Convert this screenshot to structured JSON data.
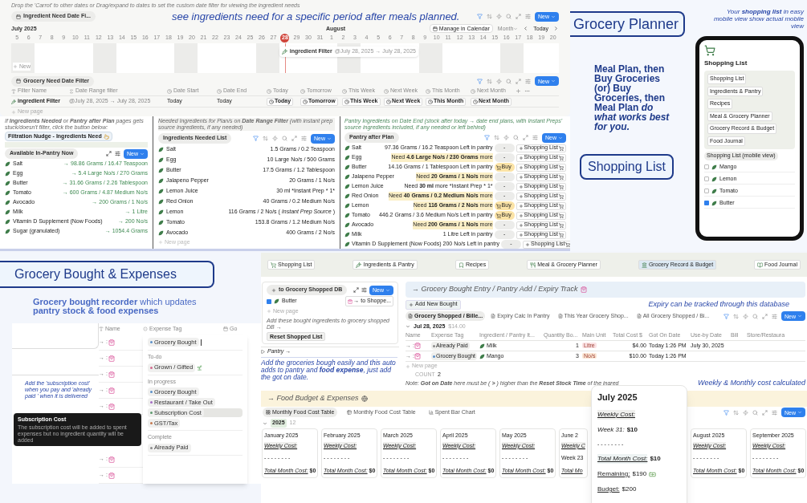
{
  "timeline_panel": {
    "hint": "Drop the 'Carrot' to other dates or Drag/expand to dates to set the custom date filter for viewing the ingredient needs",
    "view_tab": "Ingredient Need Date Fi...",
    "annotation": "see ingredients need for a specific period after meals planned.",
    "new_button": "New",
    "month_left": "July 2025",
    "month_right": "August",
    "manage_button": "Manage in Calendar",
    "range_select": "Month",
    "today_button": "Today",
    "days": [
      {
        "label": "5",
        "selected": false
      },
      {
        "label": "6",
        "selected": false
      },
      {
        "label": "7",
        "selected": false
      },
      {
        "label": "8",
        "selected": false
      },
      {
        "label": "9",
        "selected": false
      },
      {
        "label": "10",
        "selected": false
      },
      {
        "label": "11",
        "selected": false
      },
      {
        "label": "12",
        "selected": false
      },
      {
        "label": "13",
        "selected": false
      },
      {
        "label": "14",
        "selected": false
      },
      {
        "label": "15",
        "selected": false
      },
      {
        "label": "16",
        "selected": false
      },
      {
        "label": "17",
        "selected": false
      },
      {
        "label": "18",
        "selected": false
      },
      {
        "label": "19",
        "selected": false
      },
      {
        "label": "20",
        "selected": false
      },
      {
        "label": "21",
        "selected": false
      },
      {
        "label": "22",
        "selected": false
      },
      {
        "label": "23",
        "selected": false
      },
      {
        "label": "24",
        "selected": false
      },
      {
        "label": "25",
        "selected": false
      },
      {
        "label": "26",
        "selected": false
      },
      {
        "label": "27",
        "selected": false
      },
      {
        "label": "28",
        "selected": true
      },
      {
        "label": "29",
        "selected": false
      },
      {
        "label": "30",
        "selected": false
      },
      {
        "label": "31",
        "selected": false
      },
      {
        "label": "1",
        "selected": false
      },
      {
        "label": "2",
        "selected": false
      },
      {
        "label": "3",
        "selected": false
      },
      {
        "label": "4",
        "selected": false
      },
      {
        "label": "5",
        "selected": false
      },
      {
        "label": "6",
        "selected": false
      },
      {
        "label": "7",
        "selected": false
      },
      {
        "label": "8",
        "selected": false
      },
      {
        "label": "9",
        "selected": false
      },
      {
        "label": "10",
        "selected": false
      },
      {
        "label": "11",
        "selected": false
      },
      {
        "label": "12",
        "selected": false
      },
      {
        "label": "13",
        "selected": false
      },
      {
        "label": "14",
        "selected": false
      },
      {
        "label": "15",
        "selected": false
      },
      {
        "label": "16",
        "selected": false
      },
      {
        "label": "17",
        "selected": false
      },
      {
        "label": "18",
        "selected": false
      },
      {
        "label": "19",
        "selected": false
      },
      {
        "label": "20",
        "selected": false
      }
    ],
    "event": {
      "title": "ingredient Filter",
      "dates": "@July 28, 2025 → July 28, 2025"
    },
    "add_new": "New"
  },
  "filter_table": {
    "view_tab": "Grocery Need Date Filter",
    "new_button": "New",
    "columns": [
      "Filter Name",
      "Date Range filter",
      "Date Start",
      "Date End",
      "Today",
      "Tomorrow",
      "This Week",
      "Next Week",
      "This Month",
      "Next Month"
    ],
    "rows": [
      {
        "name": "ingredient Filter",
        "range": "@July 28, 2025 → July 28, 2025",
        "start": "Today",
        "end": "Today",
        "buttons": [
          "Today",
          "Tomorrow",
          "This Week",
          "Next Week",
          "This Month",
          "Next Month"
        ]
      }
    ],
    "new_page": "New page"
  },
  "pantry_now": {
    "note": "If **Ingredients Needed** or **Pantry after Plan** pages gets stuck/doesn't filter, click the button below:",
    "nudge_button": "Filtration Nudge - Ingredients Need",
    "view_tab": "Available In-Pantry Now",
    "new_button": "New",
    "items": [
      {
        "name": "Salt",
        "amount": "→ 98.86 Grams / 16.47 Teaspoon"
      },
      {
        "name": "Egg",
        "amount": "→ 5.4 Large No/s / 270 Grams"
      },
      {
        "name": "Butter",
        "amount": "→ 31.66 Grams / 2.26 Tablespoon"
      },
      {
        "name": "Tomato",
        "amount": "→ 600 Grams / 4.87 Medium No/s"
      },
      {
        "name": "Avocado",
        "amount": "→ 200 Grams / 1 No/s"
      },
      {
        "name": "Milk",
        "amount": "→ 1 Litre"
      },
      {
        "name": "Vitamin D Supplement (Now Foods)",
        "amount": "→ 200 No/s"
      },
      {
        "name": "Sugar (granulated)",
        "amount": "→ 1054.4 Grams"
      }
    ]
  },
  "needed_list": {
    "note": "Needed Ingredients for Plan/s on **Date Range Filter** (with instant prep source ingredients, if any needed)",
    "view_tab": "Ingredients Needed List",
    "new_button": "New",
    "items": [
      {
        "name": "Salt",
        "amount": "1.5 Grams / 0.2 Teaspoon"
      },
      {
        "name": "Egg",
        "amount": "10 Large No/s / 500 Grams"
      },
      {
        "name": "Butter",
        "amount": "17.5 Grams / 1.2 Tablespoon"
      },
      {
        "name": "Jalapeno Pepper",
        "amount": "20 Grams / 1 No/s"
      },
      {
        "name": "Lemon Juice",
        "amount": "30 ml *Instant Prep * 1*"
      },
      {
        "name": "Red Onion",
        "amount": "40 Grams / 0.2 Medium No/s"
      },
      {
        "name": "Lemon",
        "amount": "116 Grams / 2 No/s ( *Instant Prep Source* )"
      },
      {
        "name": "Tomato",
        "amount": "153.8 Grams / 1.2 Medium No/s"
      },
      {
        "name": "Avocado",
        "amount": "400 Grams / 2 No/s"
      }
    ],
    "new_page": "New page"
  },
  "pantry_after": {
    "note": "Pantry Ingredients on Date End (stock after today → date end plans, with Instant Preps' source ingredients included, if any needed or left behind)",
    "view_tab": "Pantry after Plan",
    "new_button": "New",
    "items": [
      {
        "name": "Salt",
        "status": "97.36 Grams / 16.2 Teaspoon Left in pantry",
        "highlighted": false,
        "tag": {
          "kind": "none",
          "label": "-"
        },
        "button": "Shopping List"
      },
      {
        "name": "Egg",
        "status": "Need **4.6 Large No/s / 230 Grams** more",
        "highlighted": true,
        "tag": {
          "kind": "none",
          "label": "-"
        },
        "button": "Shopping List"
      },
      {
        "name": "Butter",
        "status": "14.16 Grams / 1 Tablespoon Left in pantry",
        "highlighted": false,
        "tag": {
          "kind": "buy",
          "label": "Buy"
        },
        "button": "Shopping List"
      },
      {
        "name": "Jalapeno Pepper",
        "status": "Need **20 Grams / 1 No/s** more",
        "highlighted": true,
        "tag": {
          "kind": "none",
          "label": "-"
        },
        "button": "Shopping List"
      },
      {
        "name": "Lemon Juice",
        "status": "Need **30 ml** more *Instant Prep * 1*",
        "highlighted": false,
        "tag": {
          "kind": "none",
          "label": "-"
        },
        "button": "Shopping List"
      },
      {
        "name": "Red Onion",
        "status": "Need **40 Grams / 0.2 Medium No/s** more",
        "highlighted": true,
        "tag": {
          "kind": "none",
          "label": "-"
        },
        "button": "Shopping List"
      },
      {
        "name": "Lemon",
        "status": "Need **116 Grams / 2 No/s** more",
        "highlighted": true,
        "tag": {
          "kind": "buy",
          "label": "Buy"
        },
        "button": "Shopping List"
      },
      {
        "name": "Tomato",
        "status": "446.2 Grams / 3.6 Medium No/s Left in pantry",
        "highlighted": false,
        "tag": {
          "kind": "buy",
          "label": "Buy"
        },
        "button": "Shopping List"
      },
      {
        "name": "Avocado",
        "status": "Need **200 Grams / 1 No/s** more",
        "highlighted": true,
        "tag": {
          "kind": "none",
          "label": "-"
        },
        "button": "Shopping List"
      },
      {
        "name": "Milk",
        "status": "1 Litre Left in pantry",
        "highlighted": false,
        "tag": {
          "kind": "none",
          "label": "-"
        },
        "button": "Shopping List"
      },
      {
        "name": "Vitamin D Supplement (Now Foods)",
        "status": "200 No/s Left in pantry",
        "highlighted": false,
        "tag": {
          "kind": "none",
          "label": "-"
        },
        "button": "Shopping List"
      }
    ]
  },
  "planner_promo": {
    "title": "Grocery Planner",
    "annotation": "Your **shopping list** in easy mobile view show actual mobile view",
    "body": "Meal Plan, then Buy Groceries (or) Buy Groceries, then Meal Plan *do what works best for you.*",
    "title_2": "Shopping List",
    "phone": {
      "title": "Shopping List",
      "nav": [
        "Shopping List",
        "Ingredients & Pantry",
        "Recipes",
        "Meal & Grocery Planner",
        "Grocery Record & Budget",
        "Food Journal"
      ],
      "view_tab": "Shopping List (mobile view)",
      "items": [
        {
          "name": "Mango",
          "checked": false
        },
        {
          "name": "Lemon",
          "checked": false
        },
        {
          "name": "Tomato",
          "checked": false
        },
        {
          "name": "Butter",
          "checked": true
        }
      ]
    }
  },
  "expenses_promo": {
    "title": "Grocery Bought & Expenses",
    "subtitle": "**Grocery bought recorder** which updates **pantry stock & food expenses**",
    "columns": [
      "Name",
      "Expense Tag",
      "Go"
    ],
    "rows": [
      "→ :",
      "→ :",
      "→ :",
      "→ :",
      "→ :",
      "→ :",
      "→ :"
    ],
    "annotation": "Add the 'subscription cost'  when you pay and 'already paid ' when it is delivered",
    "tooltip": {
      "title": "Subscription Cost",
      "body": "The subscription cost will be added to spent expenses but no ingredient quantity will be added"
    },
    "dropdown": {
      "current": {
        "label": "Grocery Bought",
        "color": "#5b8fc9"
      },
      "groups": [
        {
          "title": "To-do",
          "options": [
            {
              "label": "Grown / Gifted",
              "color": "#d26a8e",
              "selected": false
            }
          ]
        },
        {
          "title": "In progress",
          "options": [
            {
              "label": "Grocery Bought",
              "color": "#5b8fc9",
              "selected": false
            },
            {
              "label": "Restaurant / Take Out",
              "color": "#a36cc4",
              "selected": false
            },
            {
              "label": "Subscription Cost",
              "color": "#5e9a6e",
              "selected": true
            },
            {
              "label": "GST/Tax",
              "color": "#c4784f",
              "selected": false
            }
          ]
        },
        {
          "title": "Complete",
          "options": [
            {
              "label": "Already Paid",
              "color": "#8a8a8a",
              "selected": false
            }
          ]
        }
      ]
    }
  },
  "record_page": {
    "nav": [
      {
        "label": "Shopping List",
        "selected": false
      },
      {
        "label": "Ingredients & Pantry",
        "selected": false
      },
      {
        "label": "Recipes",
        "selected": false
      },
      {
        "label": "Meal & Grocery Planner",
        "selected": false
      },
      {
        "label": "Grocery Record & Budget",
        "selected": true
      },
      {
        "label": "Food Journal",
        "selected": false
      }
    ],
    "shopped_card": {
      "view_tab": "to Grocery Shopped DB",
      "new_button": "New",
      "items": [
        {
          "name": "Butter",
          "checked": true,
          "relation": "→ to Shoppe..."
        }
      ],
      "new_page": "New page",
      "note": "Add these bought ingredients to grocery shopped DB →",
      "reset_button": "Reset Shopped List"
    },
    "pantry_toggle": "Pantry →",
    "annotation_left": "Add the groceries bough easily and this auto adds to pantry and **food expense**, just add the got on date.",
    "entry_header": "→ Grocery Bought Entry / Pantry Add / Expiry Track",
    "add_button": "Add New Bought",
    "annotation_expiry": "Expiry can be tracked through this database",
    "tabs": [
      {
        "label": "Grocery Shopped / Bille...",
        "selected": true
      },
      {
        "label": "Expiry Calc In Pantry",
        "selected": false
      },
      {
        "label": "This Year Grocery Shop...",
        "selected": false
      },
      {
        "label": "All Grocery Shopped / Bi...",
        "selected": false
      }
    ],
    "new_button": "New",
    "group": {
      "label": "Jul 28, 2025",
      "total": "$14.00"
    },
    "columns": [
      "Name",
      "Expense Tag",
      "Ingredient / Pantry It...",
      "Quantity Bo...",
      "Main Unit",
      "Total Cost $",
      "Got On Date",
      "Use-by Date",
      "Bill",
      "Store/Restaura"
    ],
    "rows": [
      {
        "name": "→ :",
        "tag": {
          "label": "Already Paid",
          "color": "#8a8a8a"
        },
        "ingredient": "Milk",
        "quantity": "1",
        "unit": {
          "label": "Litre",
          "color": "#fbe2e4"
        },
        "cost": "$4.00",
        "got_on": "Today 1:26 PM",
        "use_by": "July 30, 2025"
      },
      {
        "name": "→ :",
        "tag": {
          "label": "Grocery Bought",
          "color": "#5b8fc9"
        },
        "ingredient": "Mango",
        "quantity": "3",
        "unit": {
          "label": "No/s",
          "color": "#fbe6d4"
        },
        "cost": "$10.00",
        "got_on": "Today 1:26 PM"
      }
    ],
    "new_page": "New page",
    "count_label": "COUNT",
    "count": "2",
    "note": "Note: **Got on Date** here must be ( **>** ) higher than the **Reset Stock Time** of the ingred",
    "annotation_cost": "Weekly & Monthly cost calculated",
    "budget_new_button": "New",
    "budget_header": "→ Food Budget & Expenses",
    "budget_tabs": [
      {
        "label": "Monthly Food Cost Table",
        "selected": true,
        "kind": "gallery"
      },
      {
        "label": "Monthly Food Cost Table",
        "selected": false,
        "kind": "table"
      },
      {
        "label": "Spent Bar Chart",
        "selected": false,
        "kind": "chart"
      }
    ],
    "year_group": {
      "label": "2025",
      "count": "12"
    },
    "months": [
      {
        "title": "January 2025",
        "weekly": "Weekly Cost:",
        "dashes": "- - - - - - - -",
        "total_label": "Total Month Cost:",
        "total": "$0"
      },
      {
        "title": "February 2025",
        "weekly": "Weekly Cost:",
        "dashes": "- - - - - - - -",
        "total_label": "Total Month Cost:",
        "total": "$0"
      },
      {
        "title": "March 2025",
        "weekly": "Weekly Cost:",
        "dashes": "- - - - - - - -",
        "total_label": "Total Month Cost:",
        "total": "$0"
      },
      {
        "title": "April 2025",
        "weekly": "Weekly Cost:",
        "dashes": "- - - - - - - -",
        "total_label": "Total Month Cost:",
        "total": "$0"
      },
      {
        "title": "May 2025",
        "weekly": "Weekly Cost:",
        "dashes": "- - - - - - - -",
        "total_label": "Total Month Cost:",
        "total": "$0"
      },
      {
        "title": "June 2",
        "weekly": "Weekly C",
        "dashes": "Week 23",
        "total_label": "Total Mo"
      },
      {
        "title": "August 2025",
        "weekly": "Weekly Cost:",
        "dashes": "- - - - - - - -",
        "total_label": "Total Month Cost:",
        "total": "$0"
      },
      {
        "title": "September 2025",
        "weekly": "Weekly Cost:",
        "dashes": "- - - - - - - -",
        "total_label": "Total Month Cost:",
        "total": "$0"
      }
    ],
    "popup": {
      "title": "July 2025",
      "weekly": "Weekly Cost:",
      "week_label": "Week 31:",
      "week_value": "$10",
      "dashes": "- - - - - - - -",
      "total_label": "Total Month Cost:",
      "total": "$10",
      "remaining_label": "Remaining:",
      "remaining": "$190",
      "budget_label": "Budget:",
      "budget": "$200"
    }
  }
}
